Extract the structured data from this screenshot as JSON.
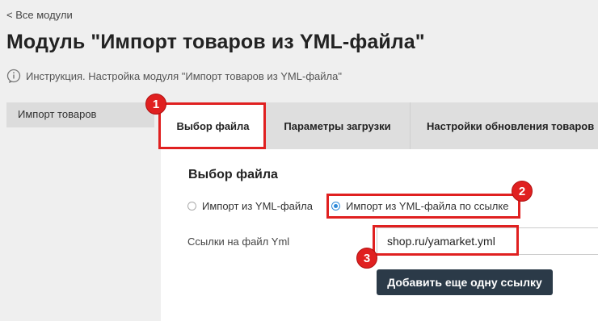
{
  "nav": {
    "back_label": "< Все модули"
  },
  "page": {
    "title": "Модуль \"Импорт товаров из YML-файла\"",
    "info_text": "Инструкция. Настройка модуля \"Импорт товаров из YML-файла\""
  },
  "sidebar": {
    "items": [
      {
        "label": "Импорт товаров",
        "selected": true
      }
    ]
  },
  "tabs": [
    {
      "label": "Выбор файла",
      "active": true
    },
    {
      "label": "Параметры загрузки",
      "active": false
    },
    {
      "label": "Настройки обновления товаров",
      "active": false
    }
  ],
  "form": {
    "section_title": "Выбор файла",
    "radios": [
      {
        "label": "Импорт из YML-файла",
        "checked": false
      },
      {
        "label": "Импорт из YML-файла по ссылке",
        "checked": true
      }
    ],
    "url_label": "Ссылки на файл Yml",
    "url_value": "shop.ru/yamarket.yml",
    "add_button_label": "Добавить еще одну ссылку"
  },
  "annotations": {
    "badges": [
      "1",
      "2",
      "3"
    ],
    "color": "#e02020"
  },
  "colors": {
    "accent": "#2f8ad8",
    "button_bg": "#2b3a48",
    "highlight": "#e02020"
  },
  "icons": {
    "info": "info-circle-icon"
  }
}
